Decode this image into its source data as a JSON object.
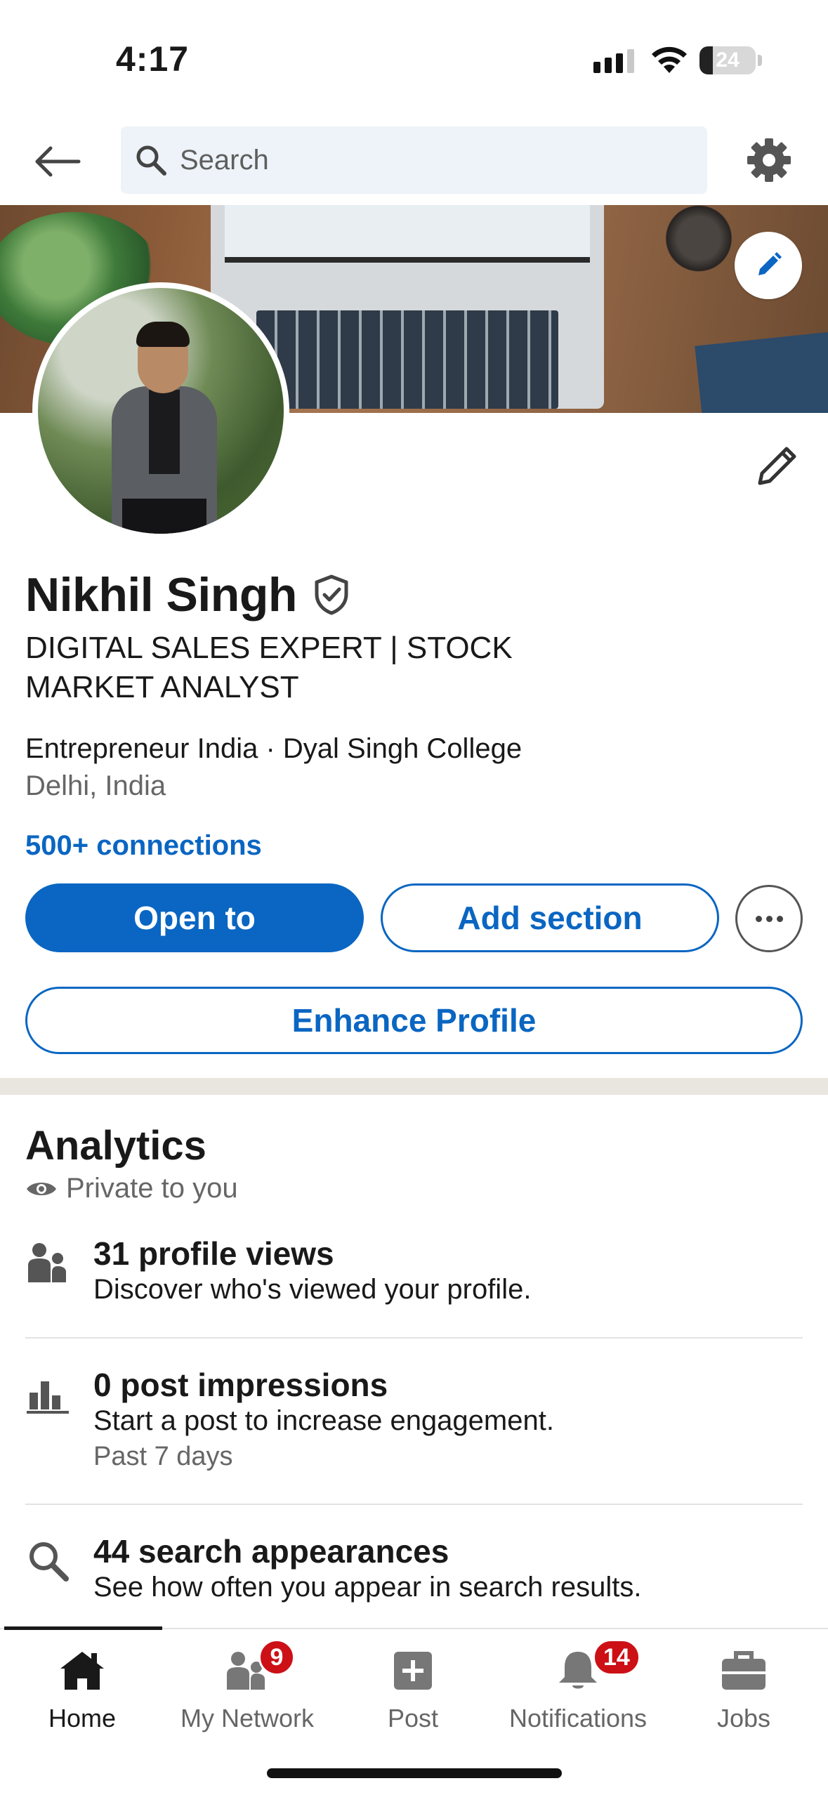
{
  "status_bar": {
    "time": "4:17",
    "battery": "24",
    "battery_level": 0.24
  },
  "header": {
    "search_placeholder": "Search"
  },
  "profile": {
    "name": "Nikhil Singh",
    "headline": "DIGITAL SALES EXPERT | STOCK MARKET ANALYST",
    "meta": "Entrepreneur India · Dyal Singh College",
    "location": "Delhi, India",
    "connections": "500+ connections"
  },
  "actions": {
    "open_to": "Open to",
    "add_section": "Add section",
    "enhance_profile": "Enhance Profile"
  },
  "analytics": {
    "title": "Analytics",
    "privacy": "Private to you",
    "items": [
      {
        "icon": "people-icon",
        "title": "31 profile views",
        "desc": "Discover who's viewed your profile.",
        "sub": ""
      },
      {
        "icon": "bar-chart-icon",
        "title": "0 post impressions",
        "desc": "Start a post to increase engagement.",
        "sub": "Past 7 days"
      },
      {
        "icon": "search-icon",
        "title": "44 search appearances",
        "desc": "See how often you appear in search results.",
        "sub": ""
      }
    ]
  },
  "nav": {
    "items": [
      {
        "label": "Home",
        "icon": "home-icon"
      },
      {
        "label": "My Network",
        "icon": "network-icon",
        "badge": "9"
      },
      {
        "label": "Post",
        "icon": "post-icon"
      },
      {
        "label": "Notifications",
        "icon": "bell-icon",
        "badge": "14"
      },
      {
        "label": "Jobs",
        "icon": "briefcase-icon"
      }
    ]
  },
  "colors": {
    "brand": "#0a66c2",
    "badge": "#cc1016",
    "text": "#191919",
    "muted": "#666666"
  }
}
